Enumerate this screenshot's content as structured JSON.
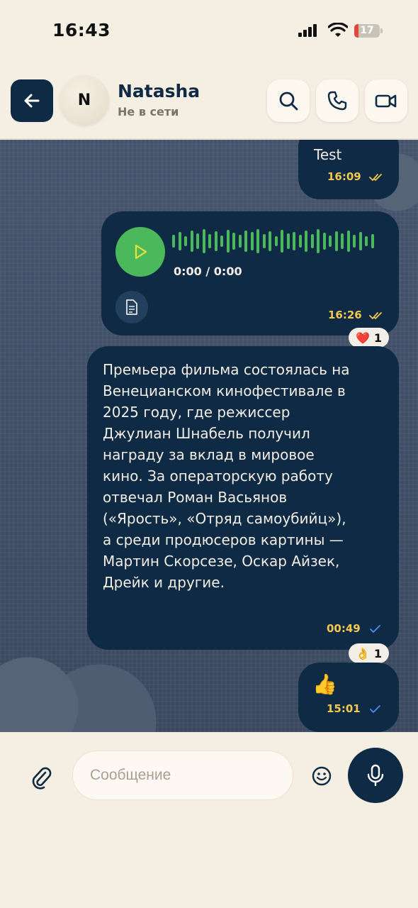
{
  "status_bar": {
    "time": "16:43",
    "battery": "17",
    "battery_level": 0.17
  },
  "header": {
    "contact_initial": "N",
    "contact_name": "Natasha",
    "contact_status": "Не в сети"
  },
  "icons": {
    "back": "arrow-left-icon",
    "search": "search-icon",
    "call": "phone-icon",
    "video": "video-camera-icon",
    "attach": "paperclip-icon",
    "emoji": "smiley-icon",
    "mic": "microphone-icon"
  },
  "colors": {
    "accent": "#0f2a44",
    "time_text": "#f2c94c",
    "play": "#4cb85c",
    "read_check": "#4a8ff0"
  },
  "messages": [
    {
      "type": "text",
      "text": "Test",
      "time": "16:09",
      "status": "read"
    },
    {
      "type": "voice",
      "duration": "0:00 / 0:00",
      "time": "16:26",
      "status": "read",
      "reaction": {
        "emoji": "❤️",
        "count": "1"
      }
    },
    {
      "type": "text",
      "text": "Премьера фильма состоялась на Венецианском кинофестивале в 2025 году, где режиссер Джулиан Шнабель получил награду за вклад в мировое кино. За операторскую работу отвечал Роман Васьянов («Ярость», «Отряд самоубийц»), а среди продюсеров картины — Мартин Скорсезе, Оскар Айзек, Дрейк и другие.",
      "time": "00:49",
      "status": "delivered",
      "reaction": {
        "emoji": "👌",
        "count": "1"
      }
    },
    {
      "type": "emoji",
      "text": "👍",
      "time": "15:01",
      "status": "delivered"
    }
  ],
  "composer": {
    "placeholder": "Сообщение",
    "value": ""
  }
}
